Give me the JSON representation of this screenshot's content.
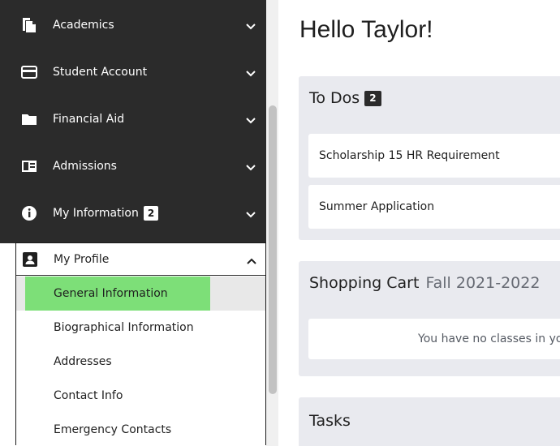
{
  "sidebar": {
    "items": [
      {
        "label": "Academics",
        "icon": "documents-icon"
      },
      {
        "label": "Student Account",
        "icon": "credit-card-icon"
      },
      {
        "label": "Financial Aid",
        "icon": "folder-icon"
      },
      {
        "label": "Admissions",
        "icon": "id-card-icon"
      },
      {
        "label": "My Information",
        "icon": "info-icon",
        "badge": "2"
      }
    ],
    "profile": {
      "label": "My Profile",
      "icon": "contact-card-icon",
      "subitems": [
        {
          "label": "General Information",
          "active": true
        },
        {
          "label": "Biographical Information"
        },
        {
          "label": "Addresses"
        },
        {
          "label": "Contact Info"
        },
        {
          "label": "Emergency Contacts"
        }
      ]
    }
  },
  "main": {
    "greeting": "Hello Taylor!",
    "todos": {
      "title": "To Dos",
      "count": "2",
      "items": [
        "Scholarship 15 HR Requirement",
        "Summer Application"
      ]
    },
    "cart": {
      "title": "Shopping Cart",
      "term": "Fall 2021-2022",
      "empty": "You have no classes in yo"
    },
    "tasks": {
      "title": "Tasks"
    }
  },
  "colors": {
    "sidebar_bg": "#2b2b2b",
    "active_highlight": "#7ddf78",
    "card_bg": "#e9eaef"
  }
}
